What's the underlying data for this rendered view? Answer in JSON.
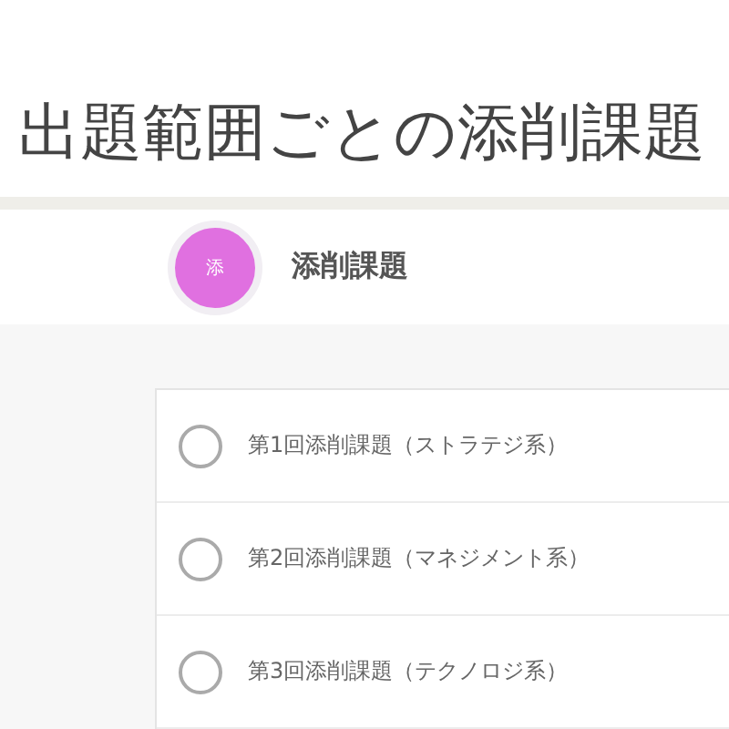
{
  "heading": "出題範囲ごとの添削課題",
  "course": {
    "avatar": "添",
    "title": "添削課題",
    "color": "#e070e0"
  },
  "items": [
    {
      "label": "第1回添削課題（ストラテジ系）",
      "selected": false
    },
    {
      "label": "第2回添削課題（マネジメント系）",
      "selected": false
    },
    {
      "label": "第3回添削課題（テクノロジ系）",
      "selected": false
    }
  ]
}
